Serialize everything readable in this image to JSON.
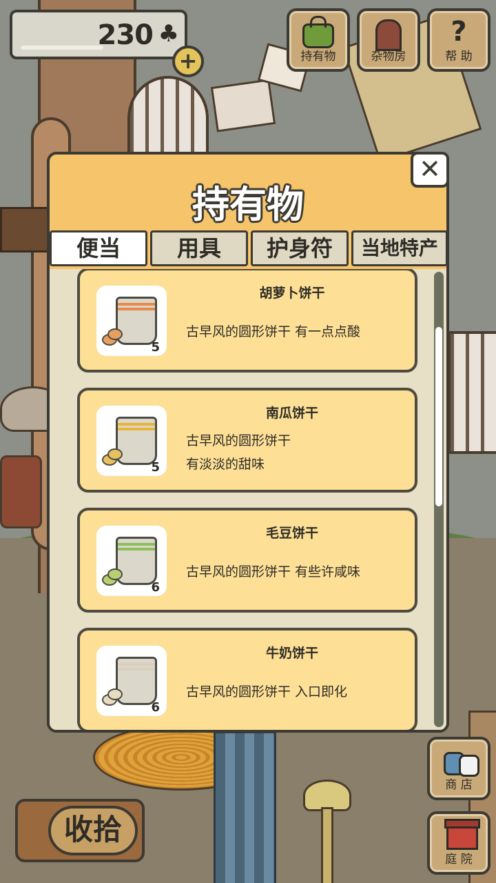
{
  "hud": {
    "clover_count": "230",
    "clover_icon": "♣",
    "plus_label": "+",
    "buttons": [
      {
        "icon": "bag-icon",
        "label": "持有物"
      },
      {
        "icon": "door-icon",
        "label": "杂物房"
      },
      {
        "icon": "question-icon",
        "label": "帮 助",
        "glyph": "?"
      }
    ]
  },
  "dialog": {
    "title": "持有物",
    "close_glyph": "✕",
    "tabs": [
      "便当",
      "用具",
      "护身符",
      "当地特产"
    ],
    "active_tab": 0,
    "items": [
      {
        "name": "胡萝卜饼干",
        "desc_lines": [
          "古早风的圆形饼干  有一点点酸"
        ],
        "qty": "5",
        "stripe_color": "#e88a4a",
        "cookie_color": "#e8a060"
      },
      {
        "name": "南瓜饼干",
        "desc_lines": [
          "古早风的圆形饼干",
          "有淡淡的甜味"
        ],
        "qty": "5",
        "stripe_color": "#e8b43a",
        "cookie_color": "#e8c060"
      },
      {
        "name": "毛豆饼干",
        "desc_lines": [
          "古早风的圆形饼干  有些许咸味"
        ],
        "qty": "6",
        "stripe_color": "#8cc05a",
        "cookie_color": "#b8d070"
      },
      {
        "name": "牛奶饼干",
        "desc_lines": [
          "古早风的圆形饼干  入口即化"
        ],
        "qty": "6",
        "stripe_color": "#d8d0bc",
        "cookie_color": "#e8dcc0"
      }
    ]
  },
  "bottom": {
    "collect_label": "收拾",
    "shop_label": "商 店",
    "yard_label": "庭 院"
  }
}
